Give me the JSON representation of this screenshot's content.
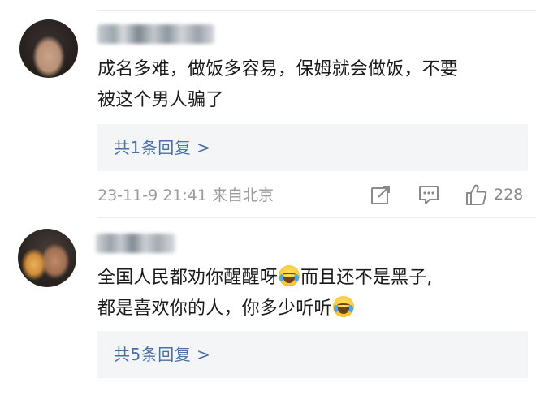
{
  "comments": [
    {
      "text_lines": [
        "成名多难，做饭多容易，保姆就会做饭，不要",
        "被这个男人骗了"
      ],
      "reply_link": "共1条回复 >",
      "timestamp": "23-11-9 21:41",
      "location": "来自北京",
      "likes": "228"
    },
    {
      "text_line1_a": "全国人民都劝你醒醒呀",
      "text_line1_b": "而且还不是黑子,",
      "text_line2": "都是喜欢你的人，你多少听听",
      "reply_link": "共5条回复 >"
    }
  ],
  "icons": {
    "emoji": "face-with-tears-of-joy-icon",
    "share": "share-icon",
    "comment": "comment-icon",
    "like": "thumbs-up-icon"
  },
  "colors": {
    "link": "#4a6fa5",
    "meta": "#9b9b9b",
    "reply_bg": "#f4f5f7"
  }
}
